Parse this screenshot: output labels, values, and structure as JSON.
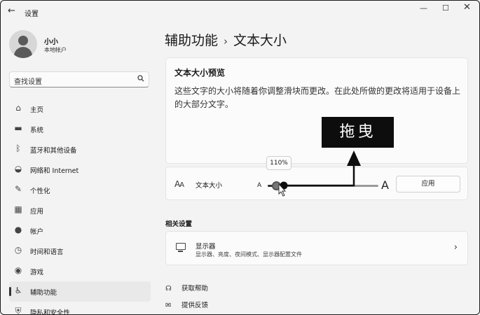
{
  "app": {
    "back_glyph": "←",
    "title": "设置",
    "controls": {
      "minimize": "—",
      "maximize": "☐",
      "close": "✕"
    }
  },
  "profile": {
    "name": "小小",
    "account_type": "本地帐户"
  },
  "search": {
    "placeholder": "查找设置",
    "icon": "search-icon"
  },
  "nav": {
    "items": [
      {
        "label": "主页",
        "icon": "home-icon",
        "glyph": "⌂"
      },
      {
        "label": "系统",
        "icon": "system-icon",
        "glyph": "▬"
      },
      {
        "label": "蓝牙和其他设备",
        "icon": "bluetooth-icon",
        "glyph": "ᛒ"
      },
      {
        "label": "网络和 Internet",
        "icon": "wifi-icon",
        "glyph": "◒"
      },
      {
        "label": "个性化",
        "icon": "brush-icon",
        "glyph": "✎"
      },
      {
        "label": "应用",
        "icon": "apps-icon",
        "glyph": "▦"
      },
      {
        "label": "帐户",
        "icon": "account-icon",
        "glyph": "●"
      },
      {
        "label": "时间和语言",
        "icon": "time-language-icon",
        "glyph": "◷"
      },
      {
        "label": "游戏",
        "icon": "gaming-icon",
        "glyph": "◉"
      },
      {
        "label": "辅助功能",
        "icon": "accessibility-icon",
        "glyph": "♿",
        "active": true
      },
      {
        "label": "隐私和安全性",
        "icon": "shield-icon",
        "glyph": "⛨"
      }
    ]
  },
  "breadcrumb": {
    "parent": "辅助功能",
    "separator": "›",
    "current": "文本大小"
  },
  "preview": {
    "title": "文本大小预览",
    "body": "这些文字的大小将随着你调整滑块而更改。在此处所做的更改将适用于设备上的大部分文字。"
  },
  "text_size": {
    "icon_big": "A",
    "icon_small": "A",
    "label": "文本大小",
    "min_glyph": "A",
    "max_glyph": "A",
    "tooltip": "110%",
    "value_percent": 110,
    "range_percent": [
      100,
      225
    ],
    "apply_label": "应用"
  },
  "annotation": {
    "label": "拖曳",
    "color": "#0d0d0d"
  },
  "related": {
    "heading": "相关设置",
    "display": {
      "title": "显示器",
      "subtitle": "显示器、亮度、夜间模式、显示器配置文件",
      "chevron": "›"
    }
  },
  "links": [
    {
      "label": "获取帮助",
      "icon": "help-icon",
      "glyph": "☊"
    },
    {
      "label": "提供反馈",
      "icon": "feedback-icon",
      "glyph": "✉"
    }
  ]
}
